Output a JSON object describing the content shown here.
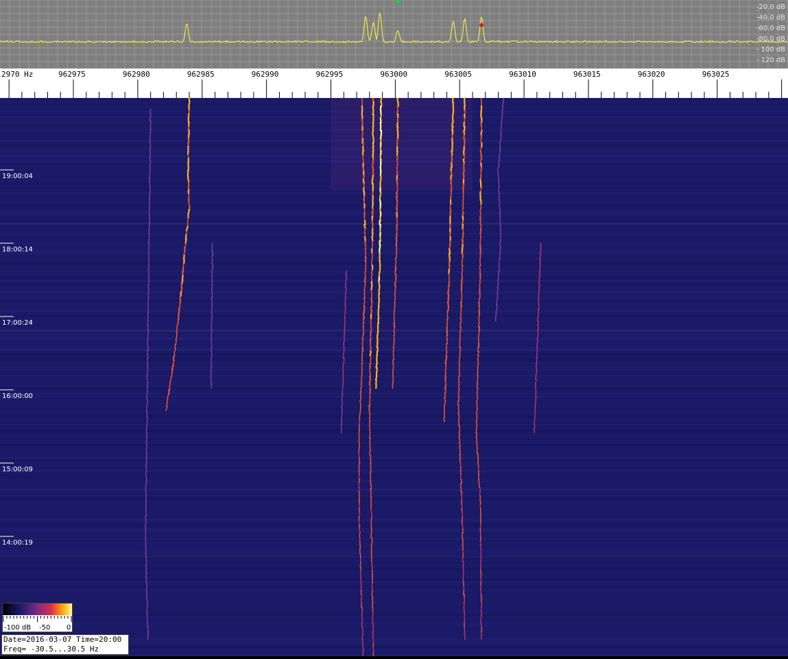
{
  "chart_data": {
    "type": "heatmap",
    "description_of_axes": "",
    "x_axis": {
      "first_label": "2970 Hz",
      "tick_labels": [
        "962975",
        "962980",
        "962985",
        "962990",
        "962995",
        "963000",
        "963005",
        "963010",
        "963015",
        "963020",
        "963025"
      ],
      "range": [
        962969.3,
        963030.5
      ]
    },
    "spectrum": {
      "db_labels": [
        "-20.0 dB",
        "-40.0 dB",
        "-60.0 dB",
        "-80.0 dB",
        "- 100 dB",
        "- 120 dB"
      ],
      "noise_floor_db": -78,
      "peaks": [
        {
          "freq": 962983.8,
          "db": -42
        },
        {
          "freq": 962997.7,
          "db": -28
        },
        {
          "freq": 962998.3,
          "db": -40
        },
        {
          "freq": 962998.8,
          "db": -22
        },
        {
          "freq": 963000.2,
          "db": -55
        },
        {
          "freq": 963004.5,
          "db": -38
        },
        {
          "freq": 963005.4,
          "db": -32
        },
        {
          "freq": 963006.7,
          "db": -30
        }
      ]
    },
    "time_axis": {
      "labels": [
        "19:00:04",
        "18:00:14",
        "17:00:24",
        "16:00:00",
        "15:00:09",
        "14:00:19"
      ]
    },
    "traces": [
      {
        "points": [
          [
            962984.0,
            0
          ],
          [
            962983.9,
            0.13
          ],
          [
            962984.0,
            0.2
          ],
          [
            962983.7,
            0.26
          ],
          [
            962983.4,
            0.34
          ],
          [
            962982.8,
            0.47
          ],
          [
            962982.2,
            0.56
          ]
        ],
        "intensity": 0.85
      },
      {
        "points": [
          [
            962981.0,
            0.02
          ],
          [
            962980.8,
            0.4
          ],
          [
            962980.6,
            0.8
          ],
          [
            962980.8,
            0.97
          ]
        ],
        "intensity": 0.3
      },
      {
        "points": [
          [
            962997.4,
            0
          ],
          [
            962997.7,
            0.3
          ],
          [
            962997.2,
            0.6
          ],
          [
            962997.2,
            0.75
          ],
          [
            962997.5,
            1.0
          ]
        ],
        "intensity": 0.8
      },
      {
        "points": [
          [
            962998.3,
            0
          ],
          [
            962998.2,
            0.3
          ],
          [
            962998.0,
            0.55
          ],
          [
            962998.1,
            0.7
          ],
          [
            962998.3,
            1.0
          ]
        ],
        "intensity": 0.85
      },
      {
        "points": [
          [
            962998.9,
            0
          ],
          [
            962998.8,
            0.3
          ],
          [
            962998.5,
            0.52
          ]
        ],
        "intensity": 1.0
      },
      {
        "points": [
          [
            963000.2,
            0
          ],
          [
            963000.1,
            0.25
          ],
          [
            962999.8,
            0.52
          ]
        ],
        "intensity": 0.8
      },
      {
        "points": [
          [
            963004.5,
            0
          ],
          [
            963004.2,
            0.3
          ],
          [
            963003.8,
            0.58
          ]
        ],
        "intensity": 0.85
      },
      {
        "points": [
          [
            963005.4,
            0
          ],
          [
            963005.2,
            0.3
          ],
          [
            963004.9,
            0.55
          ],
          [
            963005.2,
            0.75
          ],
          [
            963005.4,
            0.97
          ]
        ],
        "intensity": 0.8
      },
      {
        "points": [
          [
            963006.7,
            0
          ],
          [
            963006.6,
            0.3
          ],
          [
            963006.3,
            0.6
          ],
          [
            963006.6,
            0.72
          ],
          [
            963006.7,
            0.97
          ]
        ],
        "intensity": 0.8
      },
      {
        "points": [
          [
            963008.4,
            0
          ],
          [
            963008.0,
            0.13
          ],
          [
            963008.2,
            0.25
          ],
          [
            963007.8,
            0.4
          ]
        ],
        "intensity": 0.35
      },
      {
        "points": [
          [
            963011.3,
            0.26
          ],
          [
            963010.8,
            0.6
          ]
        ],
        "intensity": 0.55
      },
      {
        "points": [
          [
            962996.2,
            0.31
          ],
          [
            962995.8,
            0.6
          ]
        ],
        "intensity": 0.5
      },
      {
        "points": [
          [
            962985.8,
            0.26
          ],
          [
            962985.7,
            0.52
          ]
        ],
        "intensity": 0.3
      }
    ]
  },
  "legend": {
    "label_min": "-100 dB",
    "label_mid": "-50",
    "label_max": "0"
  },
  "info": {
    "line1": "Date=2016-03-07 Time=20:00",
    "line2": "Freq= -30.5...30.5 Hz"
  },
  "colors": {
    "spectrum_line": "#ffff33",
    "spectrum_bg": "#7f7f7f",
    "waterfall_bg": "#1a1a66"
  }
}
